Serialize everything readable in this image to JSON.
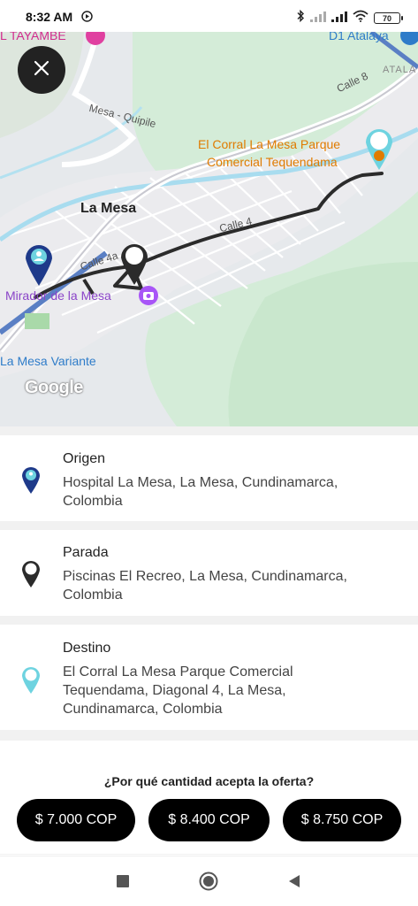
{
  "status_bar": {
    "time": "8:32 AM",
    "battery": "70",
    "icons": [
      "media-play-icon",
      "bluetooth-icon",
      "signal-icon",
      "signal-icon",
      "wifi-icon",
      "battery-icon"
    ]
  },
  "map": {
    "labels": {
      "tayambe": "L TAYAMBE",
      "d1": "D1 Atalaya",
      "atalaya": "ATALA",
      "mesa_quipile": "Mesa - Quipile",
      "calle8": "Calle 8",
      "el_corral_line1": "El Corral La Mesa Parque",
      "el_corral_line2": "Comercial Tequendama",
      "la_mesa": "La Mesa",
      "calle4": "Calle 4",
      "calle4a": "Calle 4a",
      "mirador": "Mirador de la Mesa",
      "variante": "La Mesa Variante",
      "google": "Google"
    },
    "colors": {
      "route": "#2b2b2b",
      "water": "#9ad9ee",
      "park": "#cdeccd",
      "poi_orange": "#e07b00",
      "poi_purple": "#8a44c8",
      "poi_blue": "#2e7cc9"
    }
  },
  "stops": [
    {
      "title": "Origen",
      "address": "Hospital La Mesa, La Mesa, Cundinamarca, Colombia",
      "icon": "origin-pin-icon",
      "color": "#1e3a8a"
    },
    {
      "title": "Parada",
      "address": "Piscinas El Recreo, La Mesa, Cundinamarca, Colombia",
      "icon": "stop-pin-icon",
      "color": "#2b2b2b"
    },
    {
      "title": "Destino",
      "address": "El Corral La Mesa Parque Comercial Tequendama, Diagonal 4, La Mesa, Cundinamarca, Colombia",
      "icon": "destination-pin-icon",
      "color": "#6ed3e0"
    }
  ],
  "offer": {
    "question": "¿Por qué cantidad acepta la oferta?",
    "options": [
      "$ 7.000 COP",
      "$ 8.400 COP",
      "$ 8.750 COP"
    ]
  }
}
